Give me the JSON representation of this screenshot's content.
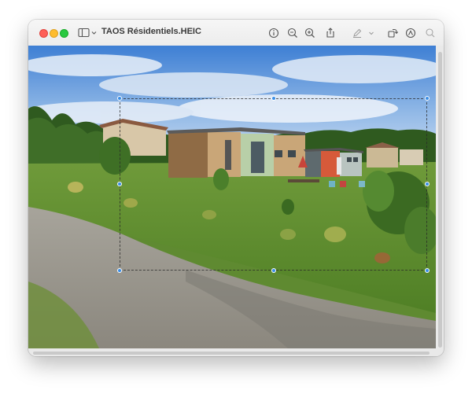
{
  "window": {
    "title": "TAOS Résidentiels.HEIC",
    "traffic_lights": {
      "close_color": "#fe5f57",
      "minimize_color": "#febc2e",
      "zoom_color": "#28c840"
    }
  },
  "toolbar": {
    "icons": [
      "sidebar-toggle-icon",
      "chevron-down-icon",
      "info-icon",
      "zoom-out-icon",
      "zoom-in-icon",
      "share-icon",
      "markup-pen-icon",
      "chevron-down-icon",
      "rotate-icon",
      "markup-toolbar-icon",
      "search-icon"
    ]
  },
  "image": {
    "subject": "photo",
    "selection_color": "#3a8ee6"
  }
}
